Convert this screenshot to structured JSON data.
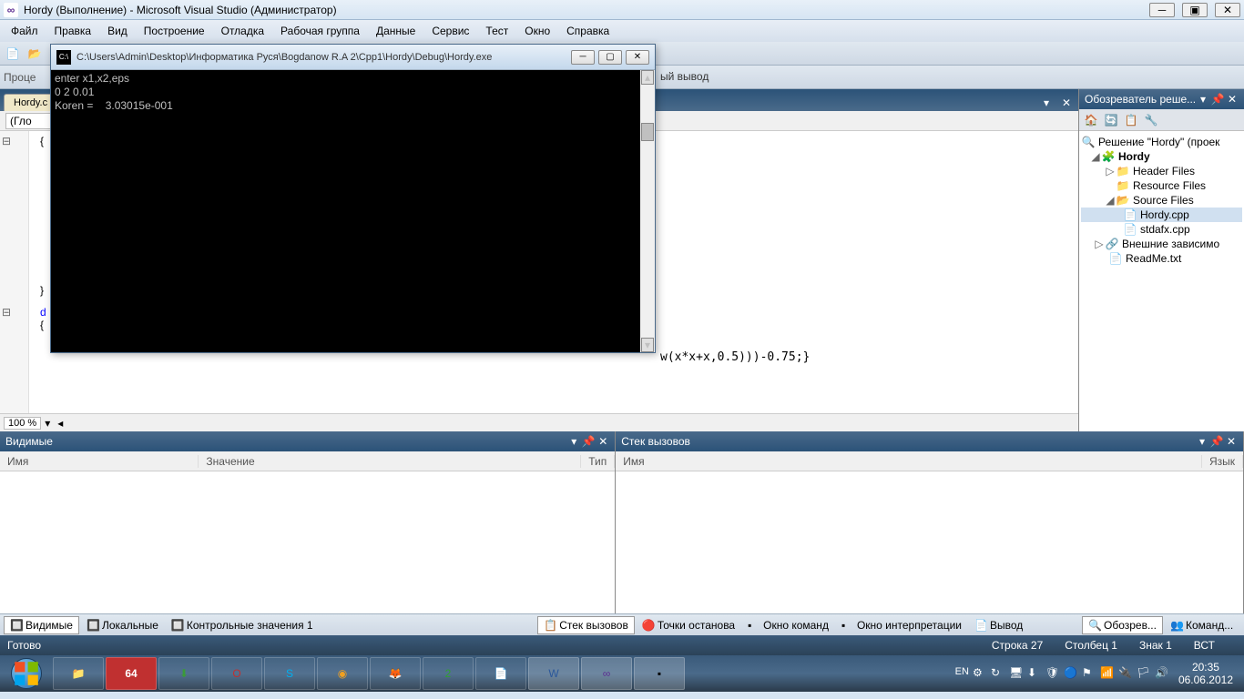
{
  "window": {
    "title": "Hordy (Выполнение) - Microsoft Visual Studio (Администратор)"
  },
  "menu": [
    "Файл",
    "Правка",
    "Вид",
    "Построение",
    "Отладка",
    "Рабочая группа",
    "Данные",
    "Сервис",
    "Тест",
    "Окно",
    "Справка"
  ],
  "toolbar2": {
    "proc_label": "Проце",
    "output_label": "ый вывод"
  },
  "editor": {
    "tab": "Hordy.c",
    "scope": "(Гло",
    "zoom": "100 %",
    "brace_open": "{",
    "brace_close": "}",
    "frag_d": "d",
    "frag_brace": "{",
    "code_fragment": "w(x*x+x,0.5)))-0.75;}"
  },
  "solution": {
    "title": "Обозреватель реше...",
    "root": "Решение \"Hordy\"  (проек",
    "project": "Hordy",
    "folders": {
      "header": "Header Files",
      "resource": "Resource Files",
      "source": "Source Files"
    },
    "files": {
      "hordy": "Hordy.cpp",
      "stdafx": "stdafx.cpp",
      "readme": "ReadMe.txt"
    },
    "external": "Внешние зависимо"
  },
  "panels": {
    "visible": {
      "title": "Видимые",
      "col_name": "Имя",
      "col_value": "Значение",
      "col_type": "Тип"
    },
    "callstack": {
      "title": "Стек вызовов",
      "col_name": "Имя",
      "col_lang": "Язык"
    }
  },
  "bottom_tabs_left": [
    {
      "label": "Видимые"
    },
    {
      "label": "Локальные"
    },
    {
      "label": "Контрольные значения 1"
    }
  ],
  "bottom_tabs_right": [
    {
      "label": "Стек вызовов"
    },
    {
      "label": "Точки останова"
    },
    {
      "label": "Окно команд"
    },
    {
      "label": "Окно интерпретации"
    },
    {
      "label": "Вывод"
    }
  ],
  "solution_tabs": [
    {
      "label": "Обозрев..."
    },
    {
      "label": "Команд..."
    }
  ],
  "status": {
    "ready": "Готово",
    "line": "Строка 27",
    "col": "Столбец 1",
    "char": "Знак 1",
    "ins": "ВСТ"
  },
  "console": {
    "title": "C:\\Users\\Admin\\Desktop\\Информатика Руся\\Bogdanow R.A 2\\Cpp1\\Hordy\\Debug\\Hordy.exe",
    "line1": "enter x1,x2,eps",
    "line2": "0 2 0.01",
    "line3": "Koren =    3.03015e-001"
  },
  "taskbar": {
    "lang": "EN",
    "time": "20:35",
    "date": "06.06.2012"
  }
}
